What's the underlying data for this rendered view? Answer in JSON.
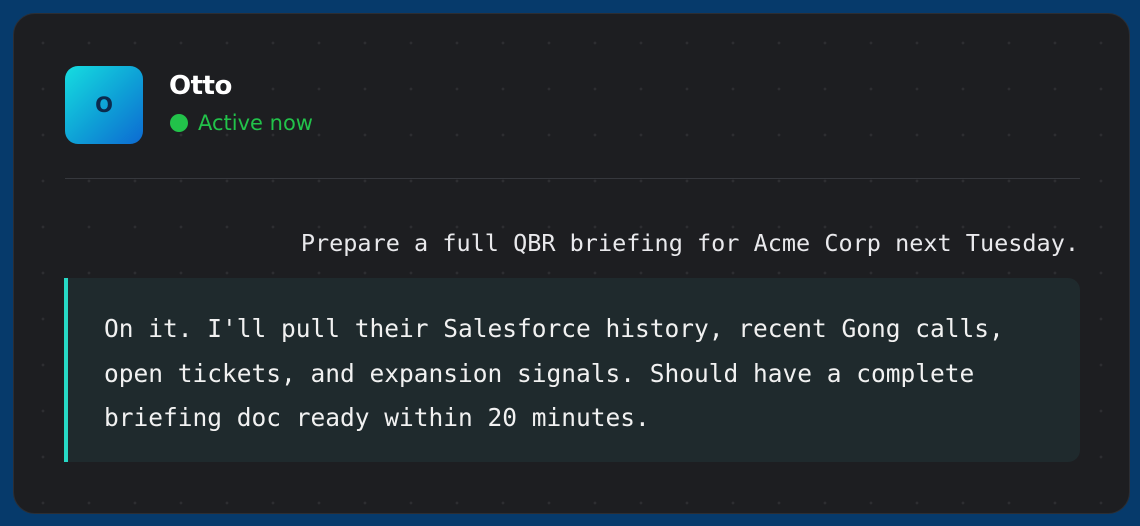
{
  "contact": {
    "name": "Otto",
    "initial": "O",
    "status": "Active now"
  },
  "messages": {
    "user": "Prepare a full QBR briefing for Acme Corp next Tuesday.",
    "assistant": "On it. I'll pull their Salesforce history, recent Gong calls, open tickets, and expansion signals. Should have a complete briefing doc ready within 20 minutes."
  },
  "colors": {
    "page_background": "#063a6b",
    "card_background": "#1d1e21",
    "status_green": "#22c24a",
    "reply_accent": "#27d9c6",
    "reply_background": "#1f2a2d"
  }
}
